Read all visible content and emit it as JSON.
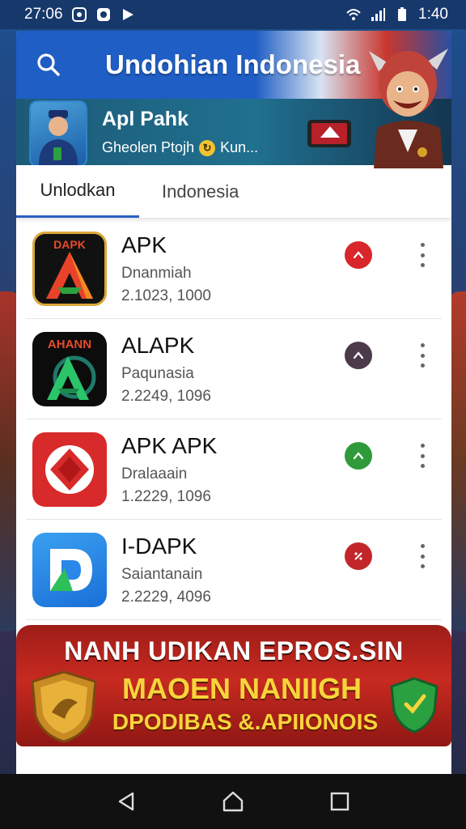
{
  "status_bar": {
    "time_left": "27:06",
    "time_right": "1:40"
  },
  "header": {
    "title": "Undohian Indonesia",
    "search_icon": "search-icon"
  },
  "promo": {
    "title": "Apl Pahk",
    "subtitle_prefix": "Gheolen Ptojh",
    "subtitle_suffix": "Kun..."
  },
  "tabs": [
    {
      "label": "Unlodkan",
      "active": true
    },
    {
      "label": "Indonesia",
      "active": false
    }
  ],
  "apps": [
    {
      "name": "APK",
      "developer": "Dnanmiah",
      "meta": "2.1023, 1000",
      "icon_text": "DAPK",
      "action_color": "#d8262a",
      "action_icon": "arrow-up-icon"
    },
    {
      "name": "ALAPK",
      "developer": "Paqunasia",
      "meta": "2.2249, 1096",
      "icon_text": "AHANN",
      "action_color": "#4a3a4a",
      "action_icon": "arrow-up-icon"
    },
    {
      "name": "APK APK",
      "developer": "Dralaaain",
      "meta": "1.2229, 1096",
      "icon_text": "",
      "action_color": "#2f9a3a",
      "action_icon": "arrow-up-icon"
    },
    {
      "name": "I-DAPK",
      "developer": "Saiantanain",
      "meta": "2.2229, 4096",
      "icon_text": "",
      "action_color": "#c2262a",
      "action_icon": "percent-icon"
    }
  ],
  "banner": {
    "line1": "NANH UDIKAN EPROS.SIN",
    "line2": "MAOEN NANIIGH",
    "line3": "DPODIBAS &.APIIONOIS"
  },
  "colors": {
    "header_blue": "#1f5ec4",
    "tab_underline": "#2b5fc4",
    "banner_red": "#c72a20",
    "banner_yellow": "#f7d43b"
  }
}
